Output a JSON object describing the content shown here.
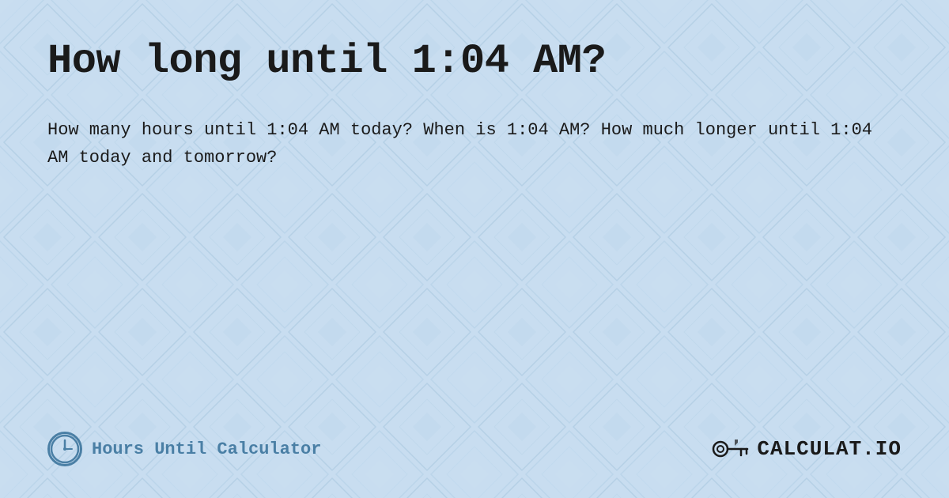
{
  "page": {
    "title": "How long until 1:04 AM?",
    "description": "How many hours until 1:04 AM today? When is 1:04 AM? How much longer until 1:04 AM today and tomorrow?",
    "background_color": "#c8dff0",
    "text_color": "#1a1a1a"
  },
  "footer": {
    "brand_label": "Hours Until Calculator",
    "logo_text": "CALCULAT.IO",
    "clock_icon": "clock-icon"
  }
}
